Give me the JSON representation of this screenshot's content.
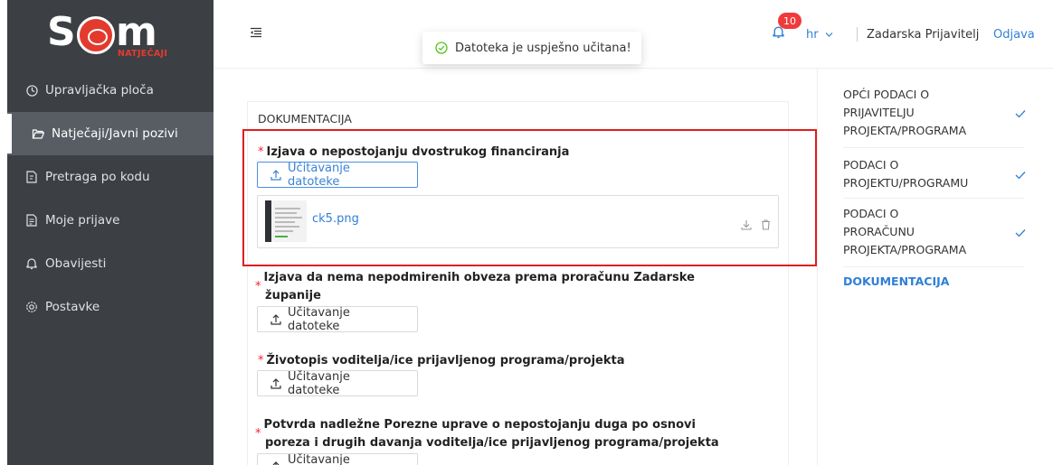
{
  "sidebar": {
    "logo": {
      "letters": "S  M",
      "subtitle": "NATJEČAJI"
    },
    "items": [
      {
        "label": "Upravljačka ploča",
        "icon": "dashboard-icon",
        "active": false
      },
      {
        "label": "Natječaji/Javni pozivi",
        "icon": "folder-open-icon",
        "active": true
      },
      {
        "label": "Pretraga po kodu",
        "icon": "file-search-icon",
        "active": false
      },
      {
        "label": "Moje prijave",
        "icon": "file-text-icon",
        "active": false
      },
      {
        "label": "Obavijesti",
        "icon": "bell-icon",
        "active": false
      },
      {
        "label": "Postavke",
        "icon": "gear-icon",
        "active": false
      }
    ]
  },
  "header": {
    "toast": "Datoteka je uspješno učitana!",
    "notification_count": "10",
    "language": "hr",
    "user": "Zadarska Prijavitelj",
    "logout": "Odjava"
  },
  "main": {
    "section_title": "DOKUMENTACIJA",
    "fields": [
      {
        "label": "Izjava o nepostojanju dvostrukog financiranja",
        "button": "Učitavanje datoteke"
      },
      {
        "label_line1": "Izjava da nema nepodmirenih obveza prema proračunu Zadarske",
        "label_line2": "županije",
        "button": "Učitavanje datoteke"
      },
      {
        "label": "Životopis voditelja/ice prijavljenog programa/projekta",
        "button": "Učitavanje datoteke"
      },
      {
        "label_line1": "Potvrda nadležne Porezne uprave o nepostojanju duga po osnovi",
        "label_line2": "poreza i drugih davanja voditelja/ice prijavljenog programa/projekta",
        "button": "Učitavanje datoteke"
      }
    ],
    "uploaded_file": {
      "name": "ck5.png"
    }
  },
  "steps": {
    "items": [
      {
        "line1": "OPĆI PODACI O",
        "line2": "PRIJAVITELJU",
        "line3": "PROJEKTA/PROGRAMA",
        "done": true
      },
      {
        "line1": "PODACI O",
        "line2": "PROJEKTU/PROGRAMU",
        "done": true
      },
      {
        "line1": "PODACI O",
        "line2": "PRORAČUNU",
        "line3": "PROJEKTA/PROGRAMA",
        "done": true
      },
      {
        "line1": "DOKUMENTACIJA",
        "current": true
      }
    ]
  },
  "colors": {
    "accent": "#2f7fd8",
    "sidebar": "#3c4045",
    "danger": "#e01e1e",
    "brand": "#e23b2e"
  }
}
